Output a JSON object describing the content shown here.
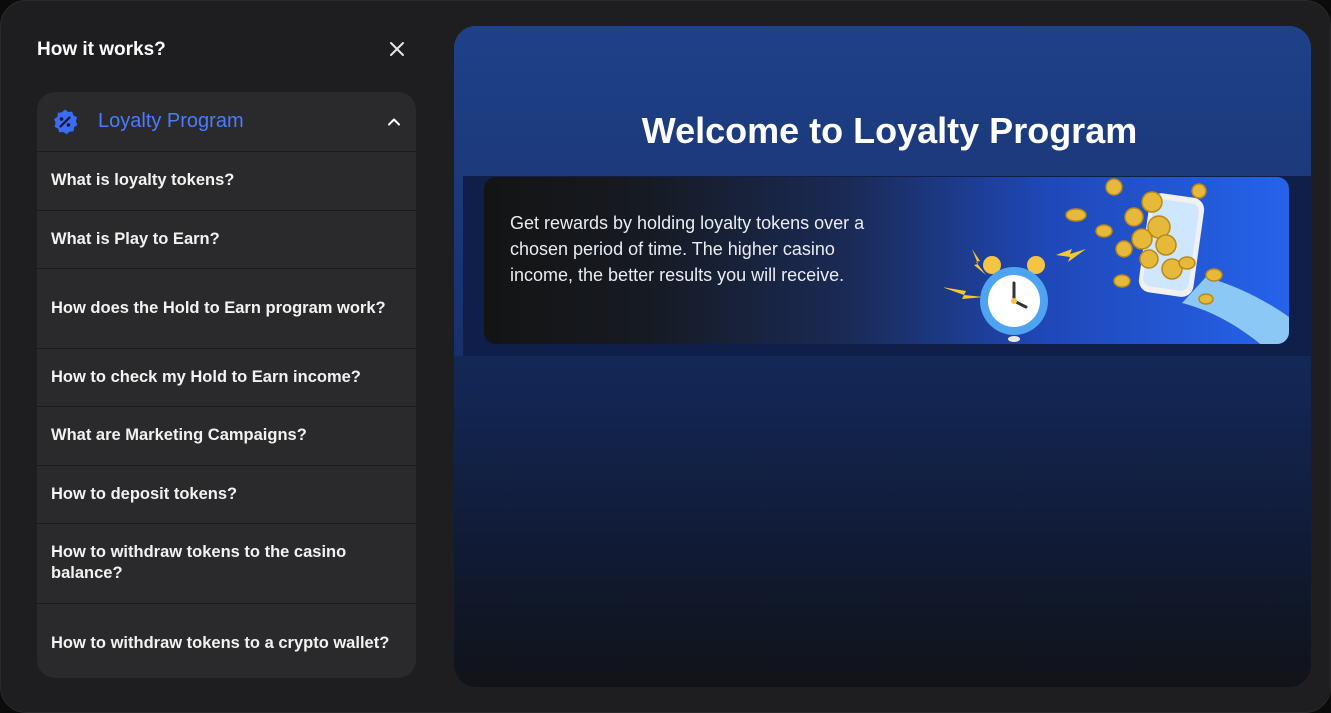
{
  "panel": {
    "title": "How it works?"
  },
  "accordion": {
    "section_label": "Loyalty Program",
    "items": [
      "What is loyalty tokens?",
      "What is Play to Earn?",
      "How does the Hold to Earn program work?",
      "How to check my Hold to Earn income?",
      "What are Marketing Campaigns?",
      "How to deposit tokens?",
      "How to withdraw tokens to the casino balance?",
      "How to withdraw tokens to a crypto wallet?"
    ]
  },
  "content": {
    "heading": "Welcome to Loyalty Program",
    "description": "Get rewards by holding loyalty tokens over a chosen period of time. The higher casino income, the better results you will receive."
  },
  "icons": {
    "close": "close-icon",
    "badge": "percent-badge-icon",
    "chevron": "chevron-up-icon"
  },
  "colors": {
    "accent": "#4b7cff",
    "panel_bg": "#1e1e20",
    "item_bg": "#2a2a2c"
  }
}
